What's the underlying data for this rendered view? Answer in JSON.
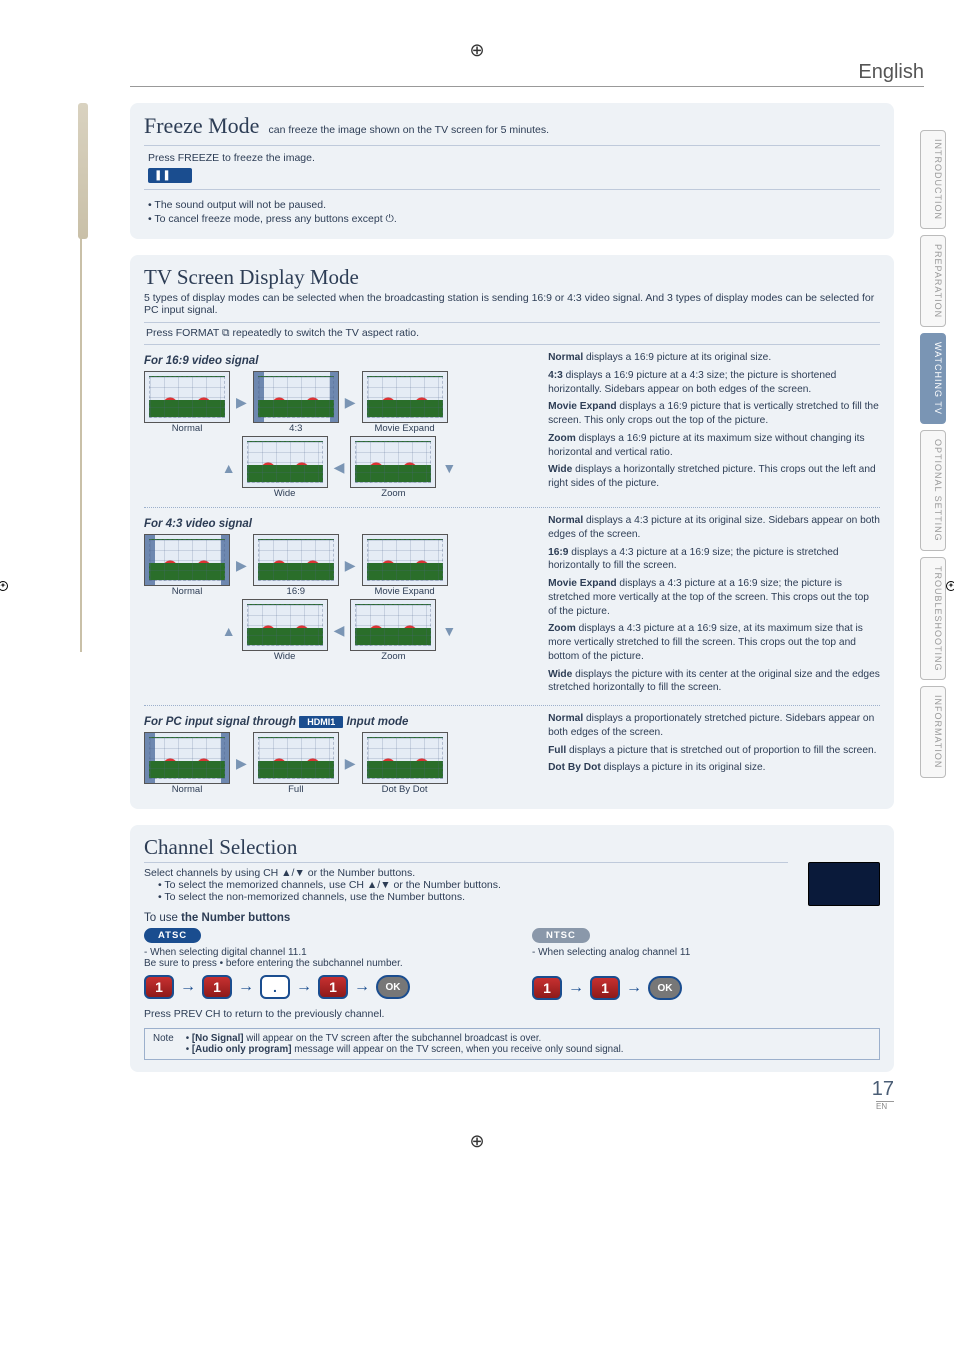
{
  "meta": {
    "language": "English",
    "page_number": "17",
    "page_lang_code": "EN"
  },
  "side_tabs": {
    "items": [
      {
        "label": "INTRODUCTION",
        "active": false
      },
      {
        "label": "PREPARATION",
        "active": false
      },
      {
        "label": "WATCHING TV",
        "active": true
      },
      {
        "label": "OPTIONAL SETTING",
        "active": false
      },
      {
        "label": "TROUBLESHOOTING",
        "active": false
      },
      {
        "label": "INFORMATION",
        "active": false
      }
    ]
  },
  "freeze": {
    "title": "Freeze Mode",
    "subtitle": " can freeze the image shown on the TV screen for 5 minutes.",
    "press_line": "Press FREEZE to freeze the image.",
    "pause_icon": "❚❚",
    "bullets": [
      "The sound output will not be paused.",
      "To cancel freeze mode, press any buttons except ⏻."
    ]
  },
  "display": {
    "title": "TV Screen Display Mode",
    "intro": "5 types of display modes can be selected when the broadcasting station is sending 16:9 or 4:3 video signal. And 3 types of display modes can be selected for PC input signal.",
    "press_line": "Press FORMAT ⧉ repeatedly to switch the TV aspect ratio.",
    "sig169_title": "For 16:9 video signal",
    "sig43_title": "For 4:3 video signal",
    "pc_title_pre": "For PC input signal through ",
    "pc_badge": "HDMI1",
    "pc_title_post": " Input mode",
    "thumb_labels": {
      "normal": "Normal",
      "r43": "4:3",
      "movie_expand": "Movie Expand",
      "wide": "Wide",
      "zoom": "Zoom",
      "r169": "16:9",
      "full": "Full",
      "dotbydot": "Dot By Dot"
    },
    "desc169": [
      {
        "b": "Normal",
        "t": " displays a 16:9 picture at its original size."
      },
      {
        "b": "4:3",
        "t": " displays a 16:9 picture at a 4:3 size; the picture is shortened horizontally. Sidebars appear on both edges of the screen."
      },
      {
        "b": "Movie Expand",
        "t": " displays a 16:9 picture that is vertically stretched to fill the screen. This only crops out the top of the picture."
      },
      {
        "b": "Zoom",
        "t": " displays a 16:9 picture at its maximum size without changing its horizontal and vertical ratio."
      },
      {
        "b": "Wide",
        "t": " displays a horizontally stretched picture. This crops out the left and right sides of the picture."
      }
    ],
    "desc43": [
      {
        "b": "Normal",
        "t": " displays a 4:3 picture at its original size. Sidebars appear on both edges of the screen."
      },
      {
        "b": "16:9",
        "t": " displays a 4:3 picture at a 16:9 size; the picture is stretched horizontally to fill the screen."
      },
      {
        "b": "Movie Expand",
        "t": " displays a 4:3 picture at a 16:9 size; the picture is stretched more vertically at the top of the screen. This crops out the top of the picture."
      },
      {
        "b": "Zoom",
        "t": " displays a 4:3 picture at a 16:9 size, at its maximum size that is more vertically stretched to fill the screen. This crops out the top and bottom of the picture."
      },
      {
        "b": "Wide",
        "t": " displays the picture with its center at the original size and the edges stretched horizontally to fill the screen."
      }
    ],
    "descpc": [
      {
        "b": "Normal",
        "t": " displays a proportionately stretched picture. Sidebars appear on both edges of the screen."
      },
      {
        "b": "Full",
        "t": " displays a picture that is stretched out of proportion to fill the screen."
      },
      {
        "b": "Dot By Dot",
        "t": " displays a picture in its original size."
      }
    ]
  },
  "channel": {
    "title": "Channel Selection",
    "intro": "Select channels by using CH ▲/▼ or the Number buttons.",
    "bullets": [
      "To select the memorized channels, use CH ▲/▼ or the Number buttons.",
      "To select the non-memorized channels, use the Number buttons."
    ],
    "numbers_title": "To use the Number buttons",
    "atsc_label": "ATSC",
    "ntsc_label": "NTSC",
    "atsc_line1": "- When selecting digital channel 11.1",
    "atsc_line2": "Be sure to press • before entering the subchannel number.",
    "ntsc_line1": "- When selecting analog channel 11",
    "atsc_seq": [
      "1",
      "1",
      ".",
      "1",
      "OK"
    ],
    "ntsc_seq": [
      "1",
      "1",
      "OK"
    ],
    "prev_line": "Press PREV CH to return to the previously channel.",
    "note_label": "Note",
    "notes": [
      "[No Signal] will appear on the TV screen after the subchannel broadcast is over.",
      "[Audio only program] message will appear on the TV screen, when you receive only sound signal."
    ]
  }
}
